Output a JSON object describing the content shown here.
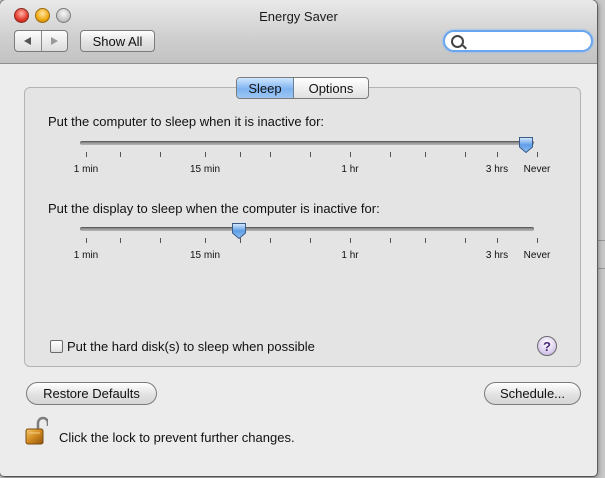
{
  "window": {
    "title": "Energy Saver"
  },
  "toolbar": {
    "back_icon": "triangle-left-icon",
    "forward_icon": "triangle-right-icon",
    "show_all_label": "Show All",
    "search_value": "",
    "search_placeholder": ""
  },
  "tabs": [
    {
      "label": "Sleep",
      "selected": true
    },
    {
      "label": "Options",
      "selected": false
    }
  ],
  "computer_sleep": {
    "label": "Put the computer to sleep when it is inactive for:",
    "tick_labels": [
      "1 min",
      "15 min",
      "1 hr",
      "3 hrs",
      "Never"
    ],
    "value": "Never"
  },
  "display_sleep": {
    "label": "Put the display to sleep when the computer is inactive for:",
    "tick_labels": [
      "1 min",
      "15 min",
      "1 hr",
      "3 hrs",
      "Never"
    ],
    "value_fraction": 0.35
  },
  "harddisk": {
    "label": "Put the hard disk(s) to sleep when possible",
    "checked": false
  },
  "help_glyph": "?",
  "buttons": {
    "restore_defaults": "Restore Defaults",
    "schedule": "Schedule..."
  },
  "lock": {
    "icon": "padlock-open-icon",
    "message": "Click the lock to prevent further changes."
  },
  "colors": {
    "accent": "#7fb4f0",
    "focus_ring": "#6aa6f0",
    "lock_gold": "#d28a1f"
  }
}
